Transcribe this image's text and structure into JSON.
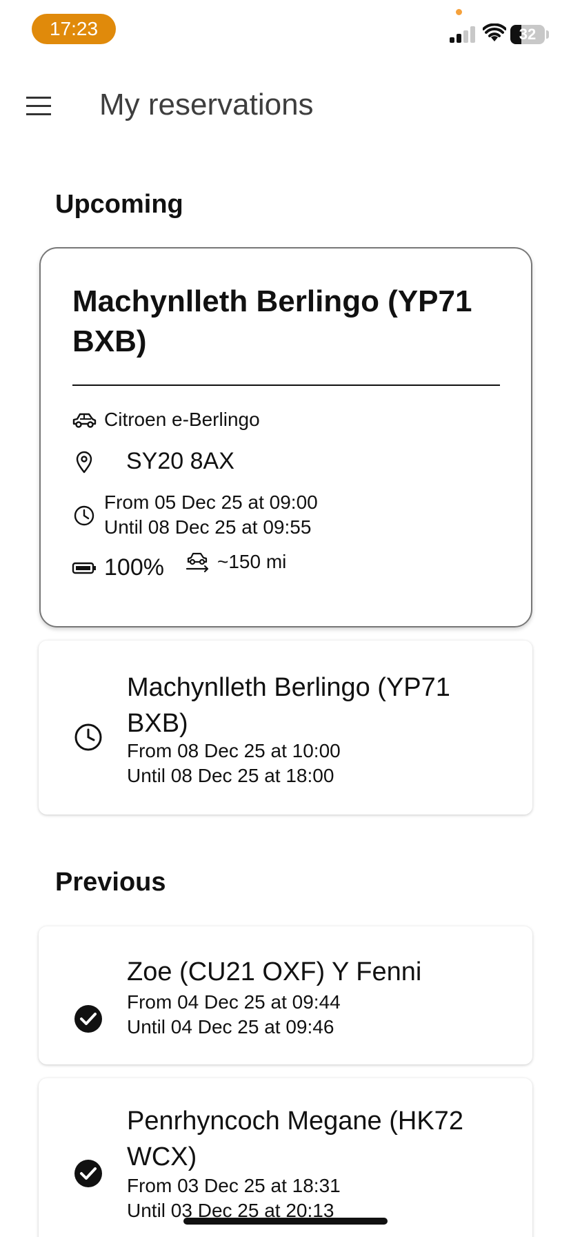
{
  "status_bar": {
    "time": "17:23",
    "battery_level": "32",
    "battery_fraction": 0.32,
    "accent_color": "#e08a0b",
    "icons": [
      "signal-icon",
      "wifi-icon",
      "battery-icon"
    ]
  },
  "app_bar": {
    "title": "My reservations",
    "menu_icon": "menu-icon"
  },
  "sections": {
    "upcoming": "Upcoming",
    "previous": "Previous"
  },
  "featured": {
    "title": "Machynlleth Berlingo (YP71 BXB)",
    "vehicle_model": "Citroen e-Berlingo",
    "postcode": "SY20 8AX",
    "from": "From 05 Dec 25 at 09:00",
    "until": "Until 08 Dec 25 at 09:55",
    "battery": "100%",
    "range": "~150 mi",
    "icons": [
      "car-icon",
      "location-pin-icon",
      "clock-icon",
      "battery-icon",
      "car-range-icon"
    ]
  },
  "upcoming_list": [
    {
      "title": "Machynlleth Berlingo (YP71 BXB)",
      "from": "From 08 Dec 25 at 10:00",
      "until": "Until 08 Dec 25 at 18:00",
      "icon": "clock-icon"
    }
  ],
  "previous_list": [
    {
      "title": "Zoe (CU21 OXF) Y Fenni",
      "from": "From 04 Dec 25 at 09:44",
      "until": "Until 04 Dec 25 at 09:46",
      "icon": "check-circle-icon"
    },
    {
      "title": "Penrhyncoch Megane (HK72 WCX)",
      "from": "From 03 Dec 25 at 18:31",
      "until": "Until 03 Dec 25 at 20:13",
      "icon": "check-circle-icon"
    }
  ]
}
